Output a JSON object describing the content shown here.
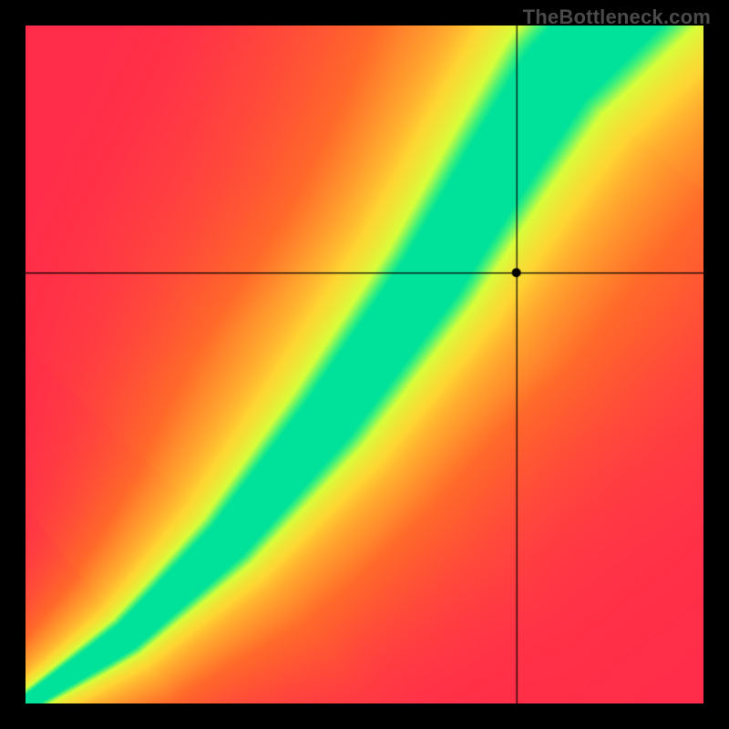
{
  "watermark": "TheBottleneck.com",
  "chart_data": {
    "type": "heatmap",
    "title": "",
    "xlabel": "",
    "ylabel": "",
    "xlim": [
      0,
      100
    ],
    "ylim": [
      0,
      100
    ],
    "color_scale": {
      "stops": [
        {
          "t": 0.0,
          "color": "#ff2d4a"
        },
        {
          "t": 0.3,
          "color": "#ff6a2a"
        },
        {
          "t": 0.55,
          "color": "#ffd633"
        },
        {
          "t": 0.78,
          "color": "#d8ff3b"
        },
        {
          "t": 0.92,
          "color": "#3bf07d"
        },
        {
          "t": 1.0,
          "color": "#00e29a"
        }
      ],
      "meaning": "fit quality (0=poor/red, 1=ideal/green)"
    },
    "ridge": {
      "description": "locus of ideal balance; super-linear curve with tapered ends",
      "control_points_xy": [
        [
          0,
          0
        ],
        [
          15,
          10
        ],
        [
          30,
          24
        ],
        [
          45,
          42
        ],
        [
          60,
          63
        ],
        [
          70,
          80
        ],
        [
          78,
          93
        ],
        [
          85,
          100
        ]
      ],
      "width_profile": [
        {
          "x": 0,
          "half_width_x": 1.2
        },
        {
          "x": 20,
          "half_width_x": 2.5
        },
        {
          "x": 45,
          "half_width_x": 4.5
        },
        {
          "x": 65,
          "half_width_x": 5.5
        },
        {
          "x": 80,
          "half_width_x": 6.5
        },
        {
          "x": 100,
          "half_width_x": 7.5
        }
      ]
    },
    "crosshair": {
      "x": 72.5,
      "y": 63.5,
      "marker_color": "#000000",
      "marker_radius_px": 5
    },
    "grid": false,
    "legend": null
  },
  "colors": {
    "frame": "#000000",
    "watermark": "#4a4a4a"
  }
}
